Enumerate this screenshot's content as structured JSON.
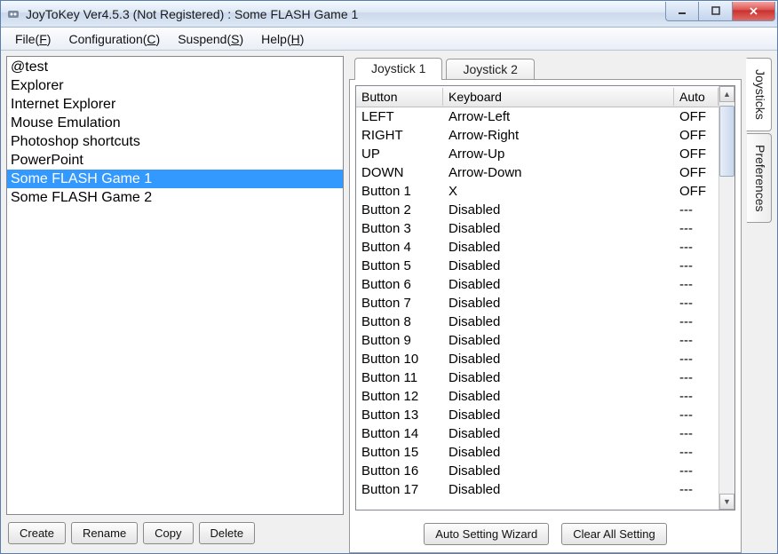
{
  "title": "JoyToKey Ver4.5.3 (Not Registered) : Some FLASH Game 1",
  "menu": {
    "file_pre": "File(",
    "file_u": "F",
    "file_post": ")",
    "config_pre": "Configuration(",
    "config_u": "C",
    "config_post": ")",
    "suspend_pre": "Suspend(",
    "suspend_u": "S",
    "suspend_post": ")",
    "help_pre": "Help(",
    "help_u": "H",
    "help_post": ")"
  },
  "profiles": [
    {
      "name": "@test",
      "selected": false
    },
    {
      "name": "Explorer",
      "selected": false
    },
    {
      "name": "Internet Explorer",
      "selected": false
    },
    {
      "name": "Mouse Emulation",
      "selected": false
    },
    {
      "name": "Photoshop shortcuts",
      "selected": false
    },
    {
      "name": "PowerPoint",
      "selected": false
    },
    {
      "name": "Some FLASH Game 1",
      "selected": true
    },
    {
      "name": "Some FLASH Game 2",
      "selected": false
    }
  ],
  "left_buttons": {
    "create": "Create",
    "rename": "Rename",
    "copy": "Copy",
    "delete": "Delete"
  },
  "tabs": {
    "joy1": "Joystick 1",
    "joy2": "Joystick 2"
  },
  "side_tabs": {
    "joysticks": "Joysticks",
    "preferences": "Preferences"
  },
  "table": {
    "headers": {
      "button": "Button",
      "keyboard": "Keyboard",
      "auto": "Auto"
    },
    "rows": [
      {
        "button": "LEFT",
        "keyboard": "Arrow-Left",
        "auto": "OFF"
      },
      {
        "button": "RIGHT",
        "keyboard": "Arrow-Right",
        "auto": "OFF"
      },
      {
        "button": "UP",
        "keyboard": "Arrow-Up",
        "auto": "OFF"
      },
      {
        "button": "DOWN",
        "keyboard": "Arrow-Down",
        "auto": "OFF"
      },
      {
        "button": "Button 1",
        "keyboard": "X",
        "auto": "OFF"
      },
      {
        "button": "Button 2",
        "keyboard": "Disabled",
        "auto": "---"
      },
      {
        "button": "Button 3",
        "keyboard": "Disabled",
        "auto": "---"
      },
      {
        "button": "Button 4",
        "keyboard": "Disabled",
        "auto": "---"
      },
      {
        "button": "Button 5",
        "keyboard": "Disabled",
        "auto": "---"
      },
      {
        "button": "Button 6",
        "keyboard": "Disabled",
        "auto": "---"
      },
      {
        "button": "Button 7",
        "keyboard": "Disabled",
        "auto": "---"
      },
      {
        "button": "Button 8",
        "keyboard": "Disabled",
        "auto": "---"
      },
      {
        "button": "Button 9",
        "keyboard": "Disabled",
        "auto": "---"
      },
      {
        "button": "Button 10",
        "keyboard": "Disabled",
        "auto": "---"
      },
      {
        "button": "Button 11",
        "keyboard": "Disabled",
        "auto": "---"
      },
      {
        "button": "Button 12",
        "keyboard": "Disabled",
        "auto": "---"
      },
      {
        "button": "Button 13",
        "keyboard": "Disabled",
        "auto": "---"
      },
      {
        "button": "Button 14",
        "keyboard": "Disabled",
        "auto": "---"
      },
      {
        "button": "Button 15",
        "keyboard": "Disabled",
        "auto": "---"
      },
      {
        "button": "Button 16",
        "keyboard": "Disabled",
        "auto": "---"
      },
      {
        "button": "Button 17",
        "keyboard": "Disabled",
        "auto": "---"
      }
    ]
  },
  "right_buttons": {
    "wizard": "Auto Setting Wizard",
    "clear": "Clear All Setting"
  }
}
